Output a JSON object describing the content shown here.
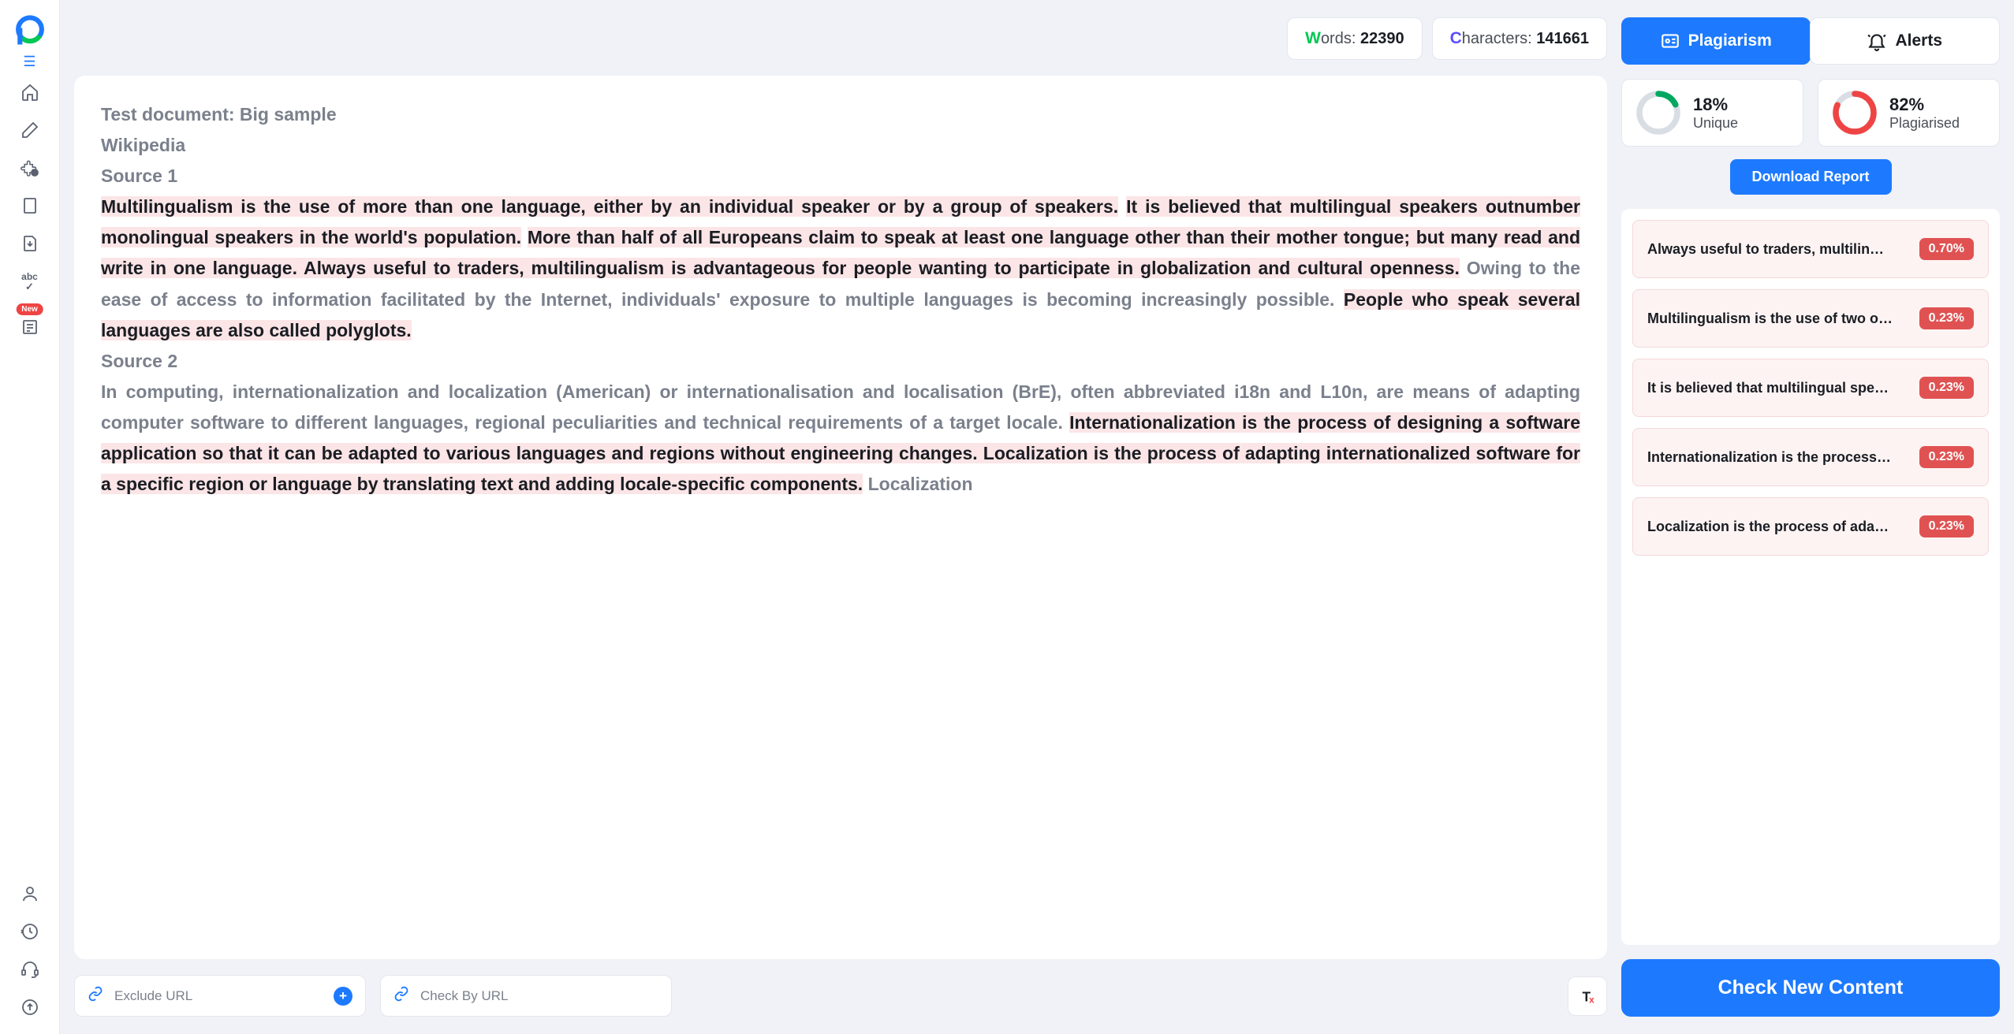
{
  "stats": {
    "words_label_prefix_letter": "W",
    "words_label_rest": "ords: ",
    "words_value": "22390",
    "chars_label_prefix_letter": "C",
    "chars_label_rest": "haracters: ",
    "chars_value": "141661"
  },
  "document": {
    "title": "Test document: Big sample",
    "subtitle": "Wikipedia",
    "source1_label": "Source 1",
    "p1_hl1": "Multilingualism is the use of more than one language, either by an individual speaker or by a group of speakers.",
    "p1_hl2": "It is believed that multilingual speakers outnumber monolingual speakers in the world's population.",
    "p1_hl3": "More than half of all Europeans claim to speak at least one language other than their mother tongue; but many read and write in one language. Always useful to traders, multilingualism is advantageous for people wanting to participate in globalization and cultural openness.",
    "p1_plain1": " Owing to the ease of access to information facilitated by the Internet, individuals' exposure to multiple languages is becoming increasingly possible. ",
    "p1_hl4": "People who speak several languages are also called polyglots.",
    "source2_label": "Source 2",
    "p2_plain1": "In computing, internationalization and localization (American) or internationalisation and localisation (BrE), often abbreviated i18n and L10n, are means of adapting computer software to different languages, regional peculiarities and technical requirements of a target locale. ",
    "p2_hl1": "Internationalization is the process of designing a software application so that it can be adapted to various languages and regions without engineering changes. Localization is the process of adapting internationalized software for a specific region or language by translating text and adding locale-specific components.",
    "p2_plain2": " Localization"
  },
  "bottom": {
    "exclude_url": "Exclude URL",
    "check_by_url": "Check By URL"
  },
  "tabs": {
    "plagiarism": "Plagiarism",
    "alerts": "Alerts"
  },
  "result": {
    "unique_pct": "18%",
    "unique_label": "Unique",
    "plag_pct": "82%",
    "plag_label": "Plagiarised",
    "download": "Download Report",
    "check_new": "Check New Content"
  },
  "matches": [
    {
      "text": "Always useful to traders, multilin…",
      "pct": "0.70%"
    },
    {
      "text": "Multilingualism is the use of two o…",
      "pct": "0.23%"
    },
    {
      "text": "It is believed that multilingual spe…",
      "pct": "0.23%"
    },
    {
      "text": "Internationalization is the process…",
      "pct": "0.23%"
    },
    {
      "text": "Localization is the process of ada…",
      "pct": "0.23%"
    }
  ],
  "sidebar": {
    "new_badge": "New",
    "abc_text": "abc"
  }
}
